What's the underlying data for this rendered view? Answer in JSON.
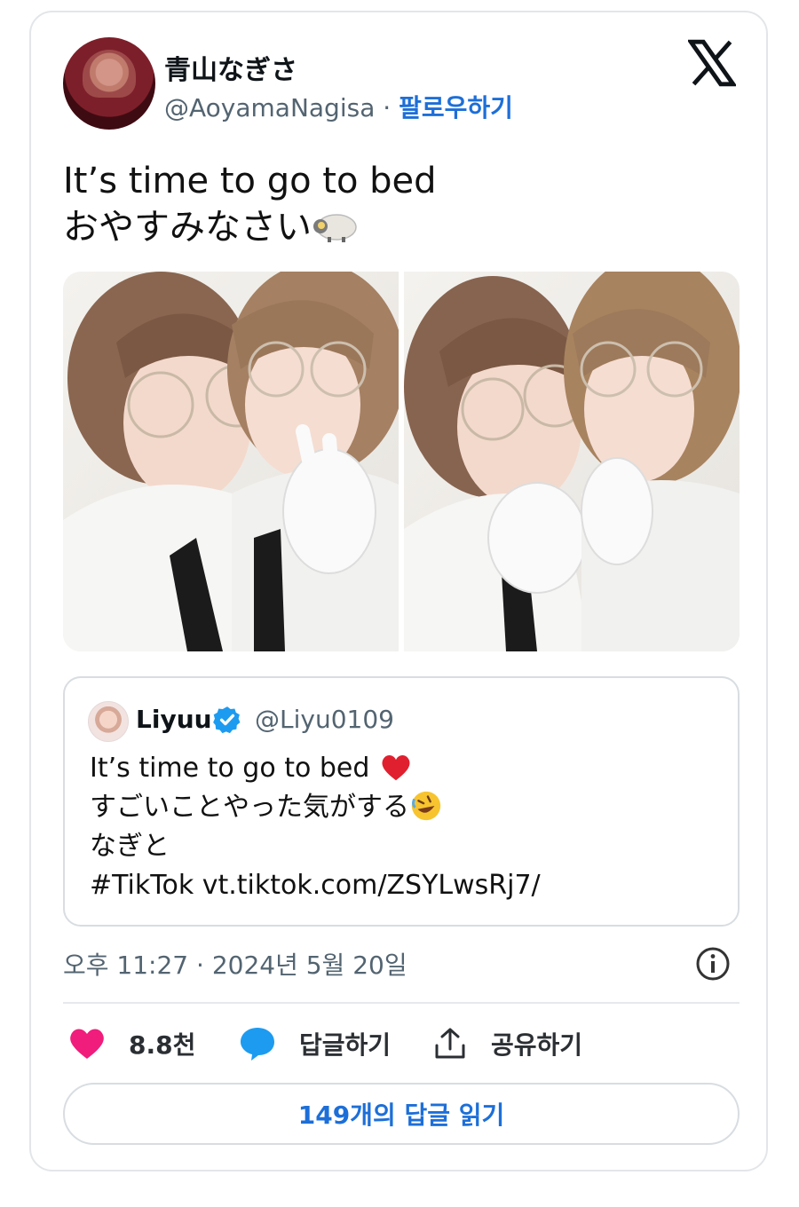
{
  "author": {
    "display_name": "青山なぎさ",
    "handle": "@AoyamaNagisa",
    "separator": " · ",
    "follow_label": "팔로우하기"
  },
  "tweet": {
    "lines": [
      "It’s time to go to bed",
      "おやすみなさい"
    ]
  },
  "quoted_tweet": {
    "display_name": "Liyuu",
    "handle": "@Liyu0109",
    "lines": [
      "It’s time to go to bed",
      "すごいことやった気がする",
      "なぎと",
      "#TikTok vt.tiktok.com/ZSYLwsRj7/"
    ]
  },
  "meta": {
    "timestamp": "오후 11:27 · 2024년 5월 20일"
  },
  "actions": {
    "like_count": "8.8천",
    "reply_label": "답글하기",
    "share_label": "공유하기"
  },
  "read_replies_label": "149개의 답글 읽기",
  "colors": {
    "accent": "#1d6fd8",
    "like": "#f01d7c",
    "reply": "#1d9bf0",
    "muted": "#536471"
  },
  "icons": [
    "x-logo-icon",
    "sheep-emoji-icon",
    "verified-badge-icon",
    "red-heart-emoji-icon",
    "rofl-emoji-icon",
    "info-icon",
    "heart-icon",
    "reply-bubble-icon",
    "share-icon"
  ]
}
